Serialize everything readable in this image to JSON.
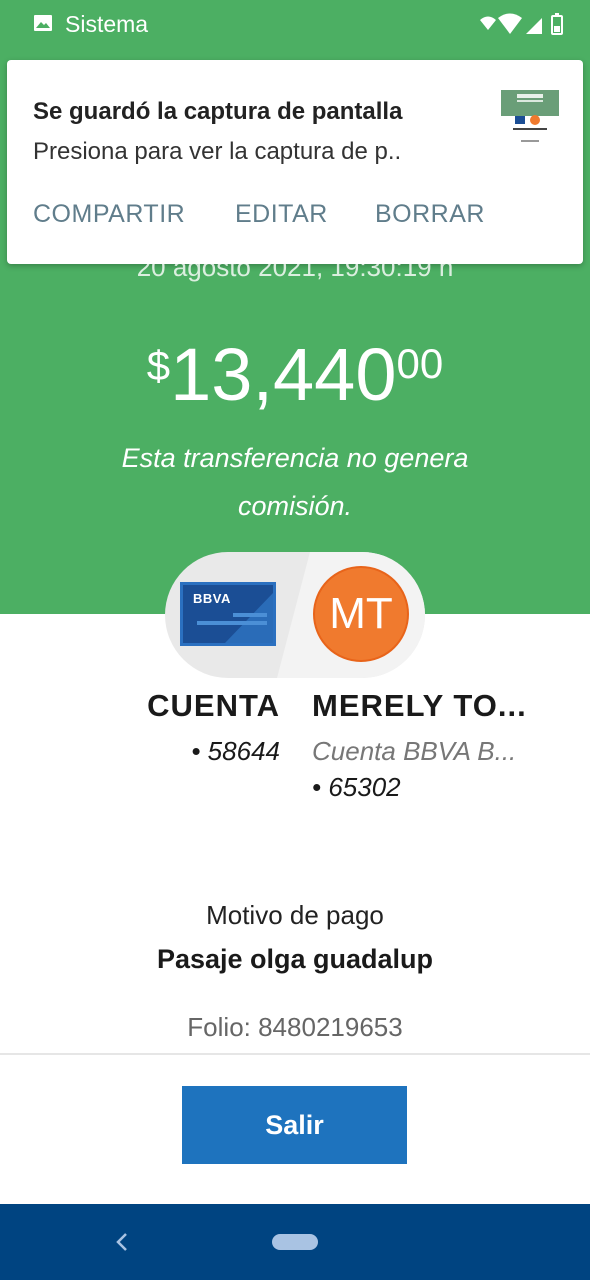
{
  "status_bar": {
    "title": "Sistema",
    "icons": [
      "image-icon",
      "wifi-icon",
      "signal-icon",
      "battery-icon"
    ]
  },
  "notification": {
    "title": "Se guardó la captura de pantalla",
    "text": "Presiona para ver la captura de p..",
    "actions": [
      "COMPARTIR",
      "EDITAR",
      "BORRAR"
    ]
  },
  "transfer": {
    "date": "20 agosto 2021, 19:30:19 h",
    "amount_currency": "$",
    "amount_integer": "13,440",
    "amount_decimal": "00",
    "commission_text": "Esta transferencia no genera comisión."
  },
  "from_account": {
    "card_brand": "BBVA",
    "name": "CUENTA",
    "number": "• 58644"
  },
  "to_account": {
    "initials": "MT",
    "name": "MERELY TO...",
    "bank": "Cuenta BBVA B...",
    "number": "• 65302"
  },
  "details": {
    "motivo_label": "Motivo de pago",
    "motivo_value": "Pasaje olga guadalup",
    "folio": "Folio: 8480219653"
  },
  "actions": {
    "exit_label": "Salir"
  },
  "colors": {
    "header_green": "#4caf63",
    "primary_blue": "#1e73be",
    "navbar_blue": "#004481",
    "avatar_orange": "#f07a2e"
  }
}
